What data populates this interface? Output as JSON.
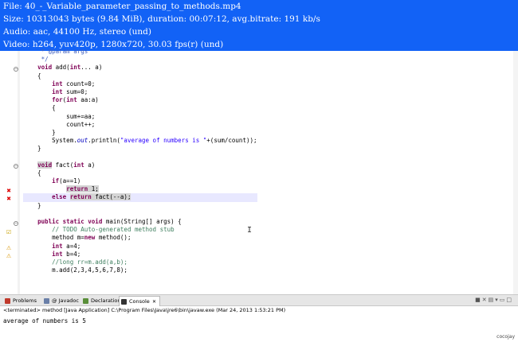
{
  "info": {
    "file": "File: 40_-_Variable_parameter_passing_to_methods.mp4",
    "size": "Size: 10313043 bytes (9.84 MiB), duration: 00:07:12, avg.bitrate: 191 kb/s",
    "audio": "Audio: aac, 44100 Hz, stereo (und)",
    "video": "Video: h264, yuv420p, 1280x720, 30.03 fps(r) (und)"
  },
  "code_lines": [
    "     * @param args",
    "     */",
    "    void add(int... a)",
    "    {",
    "        int count=0;",
    "        int sum=0;",
    "        for(int aa:a)",
    "        {",
    "            sum+=aa;",
    "            count++;",
    "        }",
    "        System.out.println(\"average of numbers is \"+(sum/count));",
    "    }",
    "",
    "    void fact(int a)",
    "    {",
    "        if(a==1)",
    "            return 1;",
    "        else return fact(--a);",
    "    }",
    "",
    "    public static void main(String[] args) {",
    "        // TODO Auto-generated method stub",
    "        method m=new method();",
    "        int a=4;",
    "        int b=4;",
    "        //long rr=m.add(a,b);",
    "        m.add(2,3,4,5,6,7,8);"
  ],
  "bottom": {
    "tabs": [
      {
        "label": "Problems",
        "color": "#c0392b"
      },
      {
        "label": "@ Javadoc",
        "color": "#6a7fa8"
      },
      {
        "label": "Declaration",
        "color": "#5a8f3a"
      },
      {
        "label": "Console",
        "color": "#333333"
      }
    ],
    "close_glyph": "✕",
    "console_title": "<terminated> method [Java Application] C:\\Program Files\\Java\\jre6\\bin\\javaw.exe (Mar 24, 2013 1:53:21 PM)",
    "console_output": "average of numbers is 5"
  },
  "watermark": "cocojay"
}
